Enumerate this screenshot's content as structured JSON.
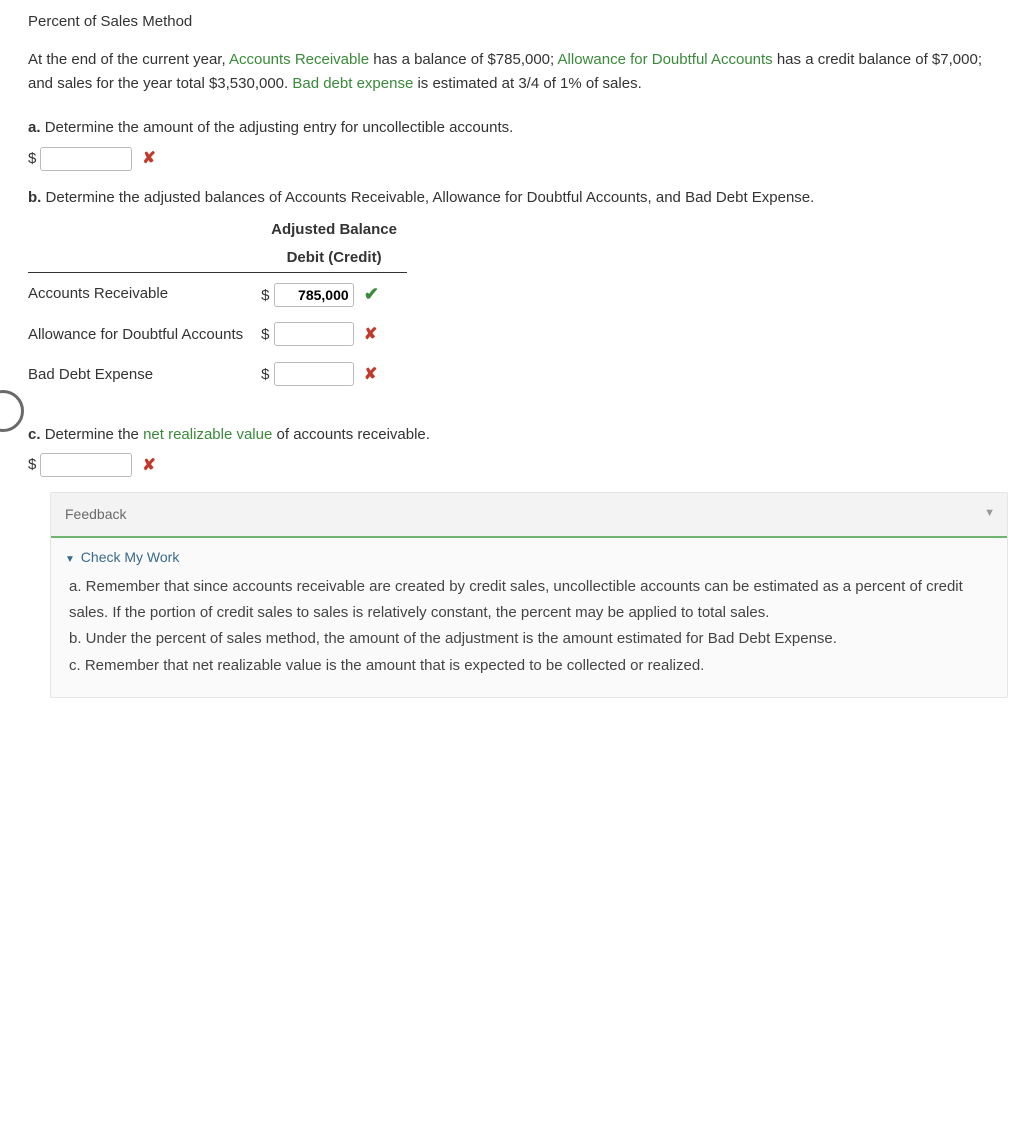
{
  "title": "Percent of Sales Method",
  "intro": {
    "p1a": "At the end of the current year, ",
    "term1": "Accounts Receivable",
    "p1b": " has a balance of $785,000; ",
    "term2": "Allowance for Doubtful Accounts",
    "p1c": " has a credit balance of $7,000; and sales for the year total $3,530,000. ",
    "term3": "Bad debt expense",
    "p1d": " is estimated at 3/4 of 1% of sales."
  },
  "a": {
    "label": "a.",
    "text": "Determine the amount of the adjusting entry for uncollectible accounts.",
    "dollar": "$",
    "value": "",
    "mark": "✘"
  },
  "b": {
    "label": "b.",
    "text": "Determine the adjusted balances of Accounts Receivable, Allowance for Doubtful Accounts, and Bad Debt Expense.",
    "header1": "Adjusted Balance",
    "header2": "Debit (Credit)",
    "rows": [
      {
        "acct": "Accounts Receivable",
        "dollar": "$",
        "value": "785,000",
        "mark": "✔",
        "correct": true
      },
      {
        "acct": "Allowance for Doubtful Accounts",
        "dollar": "$",
        "value": "",
        "mark": "✘",
        "correct": false
      },
      {
        "acct": "Bad Debt Expense",
        "dollar": "$",
        "value": "",
        "mark": "✘",
        "correct": false
      }
    ]
  },
  "c": {
    "label": "c.",
    "pre": "Determine the ",
    "term": "net realizable value",
    "post": " of accounts receivable.",
    "dollar": "$",
    "value": "",
    "mark": "✘"
  },
  "feedback": {
    "title": "Feedback",
    "chev": "▼",
    "sub_tri": "▼",
    "sub": "Check My Work",
    "body_a": "a. Remember that since accounts receivable are created by credit sales, uncollectible accounts can be estimated as a percent of credit sales. If the portion of credit sales to sales is relatively constant, the percent may be applied to total sales.",
    "body_b": "b. Under the percent of sales method, the amount of the adjustment is the amount estimated for Bad Debt Expense.",
    "body_c": "c. Remember that net realizable value is the amount that is expected to be collected or realized."
  }
}
